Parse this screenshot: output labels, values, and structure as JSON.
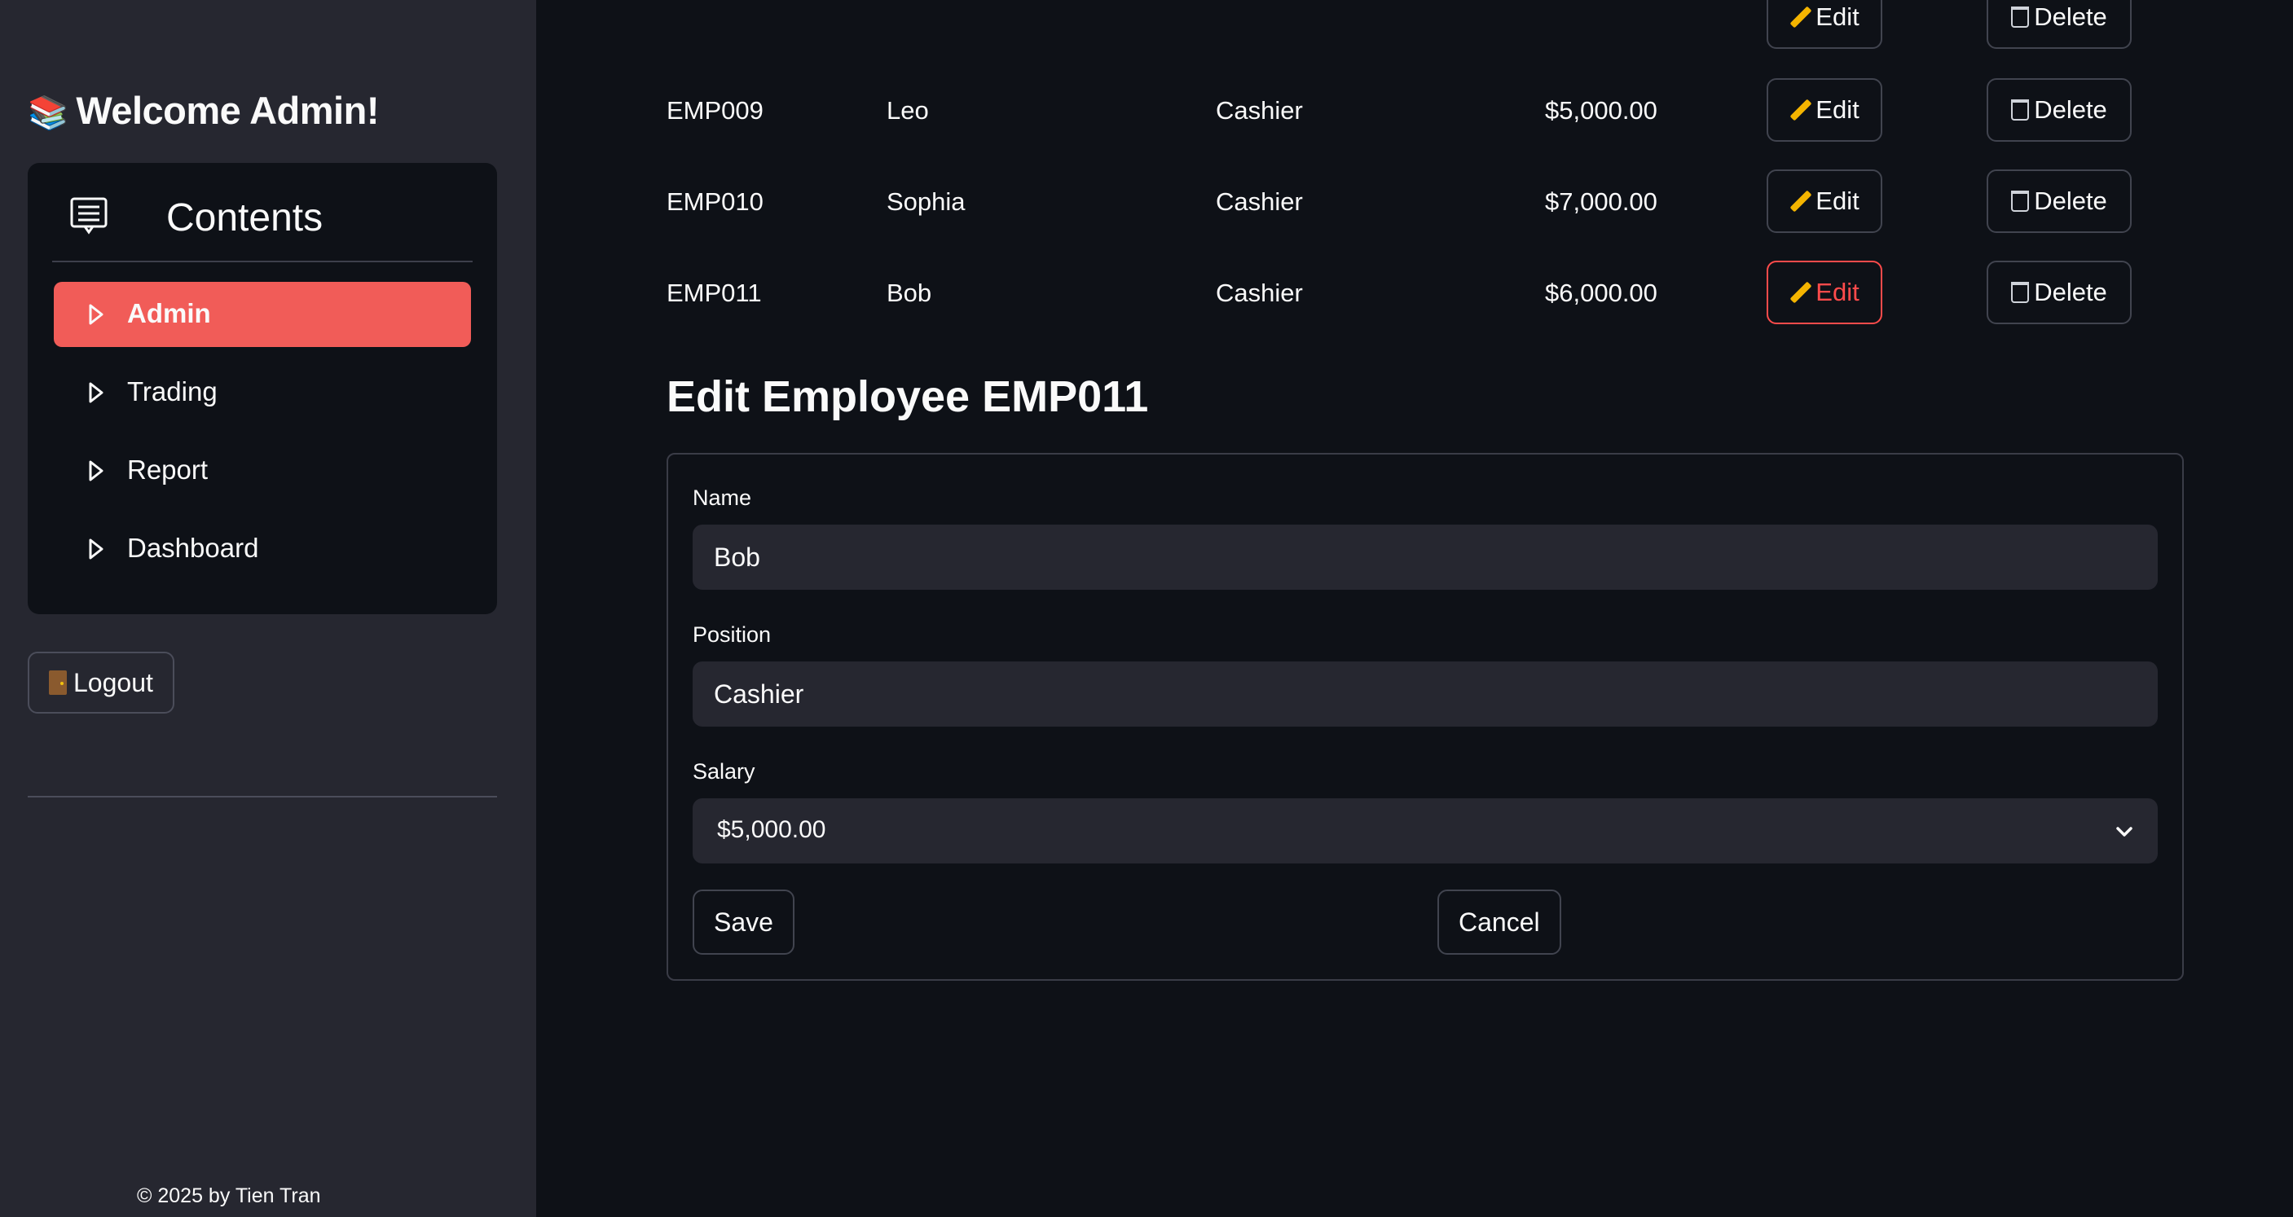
{
  "sidebar": {
    "welcome": "Welcome Admin!",
    "menu_title": "Contents",
    "items": [
      {
        "label": "Admin",
        "active": true
      },
      {
        "label": "Trading",
        "active": false
      },
      {
        "label": "Report",
        "active": false
      },
      {
        "label": "Dashboard",
        "active": false
      }
    ],
    "logout_label": "Logout",
    "footer": "© 2025 by Tien Tran"
  },
  "table": {
    "rows": [
      {
        "id": "EMP009",
        "name": "Leo",
        "position": "Cashier",
        "salary": "$5,000.00"
      },
      {
        "id": "EMP010",
        "name": "Sophia",
        "position": "Cashier",
        "salary": "$7,000.00"
      },
      {
        "id": "EMP011",
        "name": "Bob",
        "position": "Cashier",
        "salary": "$6,000.00"
      }
    ],
    "edit_label": "Edit",
    "delete_label": "Delete"
  },
  "form": {
    "title": "Edit Employee EMP011",
    "name_label": "Name",
    "name_value": "Bob",
    "position_label": "Position",
    "position_value": "Cashier",
    "salary_label": "Salary",
    "salary_value": "$5,000.00",
    "save_label": "Save",
    "cancel_label": "Cancel"
  },
  "colors": {
    "accent": "#f15c58",
    "sidebar_bg": "#262730",
    "main_bg": "#0e1117",
    "active_border": "#ff4b4b"
  }
}
